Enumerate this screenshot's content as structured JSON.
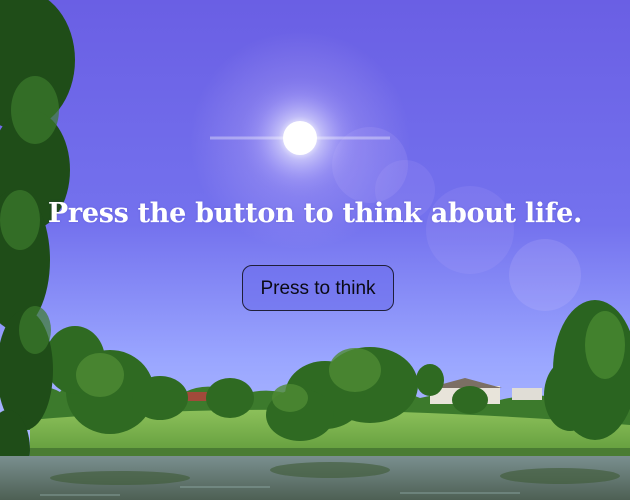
{
  "page": {
    "headline": "Press the button to think about life.",
    "button_label": "Press to think"
  },
  "colors": {
    "sky": "#6b64e6",
    "sky_horizon": "#a9b2ff",
    "sun": "#ffffff",
    "grass": "#7bb24a",
    "trees": "#2f6a22",
    "water": "#566d5e",
    "headline_text": "#ffffff",
    "button_fill": "#7d7ef0",
    "button_border": "#1f1f3a"
  },
  "icons": {
    "sun": "sun-icon"
  }
}
